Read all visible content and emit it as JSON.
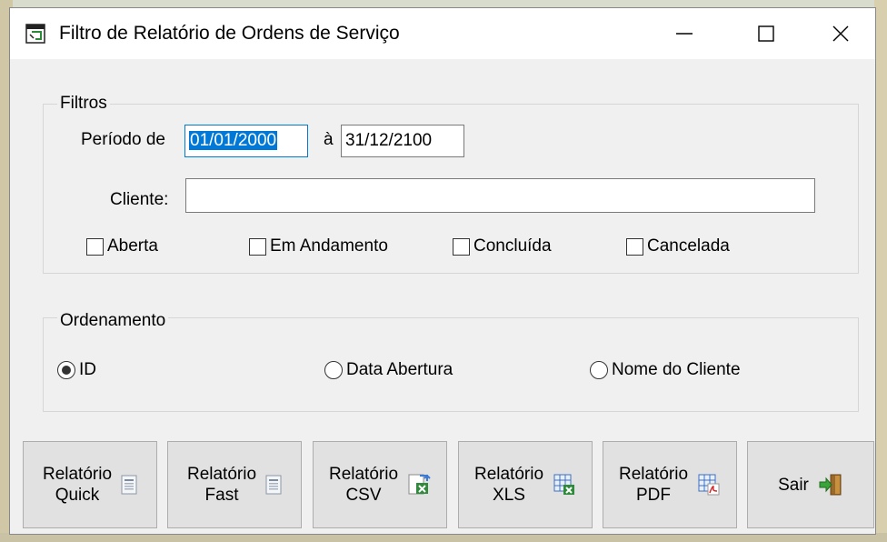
{
  "window": {
    "title": "Filtro de Relatório de Ordens de Serviço",
    "controls": {
      "minimize": "—",
      "maximize": "☐",
      "close": "✕"
    }
  },
  "filters": {
    "group_label": "Filtros",
    "period_label": "Período de",
    "period_from": "01/01/2000",
    "period_separator": "à",
    "period_to": "31/12/2100",
    "client_label": "Cliente:",
    "client_value": "",
    "status_checkboxes": [
      {
        "label": "Aberta",
        "checked": false
      },
      {
        "label": "Em Andamento",
        "checked": false
      },
      {
        "label": "Concluída",
        "checked": false
      },
      {
        "label": "Cancelada",
        "checked": false
      }
    ]
  },
  "ordering": {
    "group_label": "Ordenamento",
    "options": [
      {
        "label": "ID",
        "selected": true
      },
      {
        "label": "Data Abertura",
        "selected": false
      },
      {
        "label": "Nome do Cliente",
        "selected": false
      }
    ]
  },
  "buttons": [
    {
      "line1": "Relatório",
      "line2": "Quick",
      "icon": "report-quick-icon"
    },
    {
      "line1": "Relatório",
      "line2": "Fast",
      "icon": "report-fast-icon"
    },
    {
      "line1": "Relatório",
      "line2": "CSV",
      "icon": "csv-export-icon"
    },
    {
      "line1": "Relatório",
      "line2": "XLS",
      "icon": "xls-export-icon"
    },
    {
      "line1": "Relatório",
      "line2": "PDF",
      "icon": "pdf-export-icon"
    },
    {
      "label": "Sair",
      "icon": "exit-door-icon"
    }
  ],
  "colors": {
    "focus": "#0078d7",
    "selection": "#0078d7",
    "face": "#f0f0f0",
    "button": "#e1e1e1"
  }
}
